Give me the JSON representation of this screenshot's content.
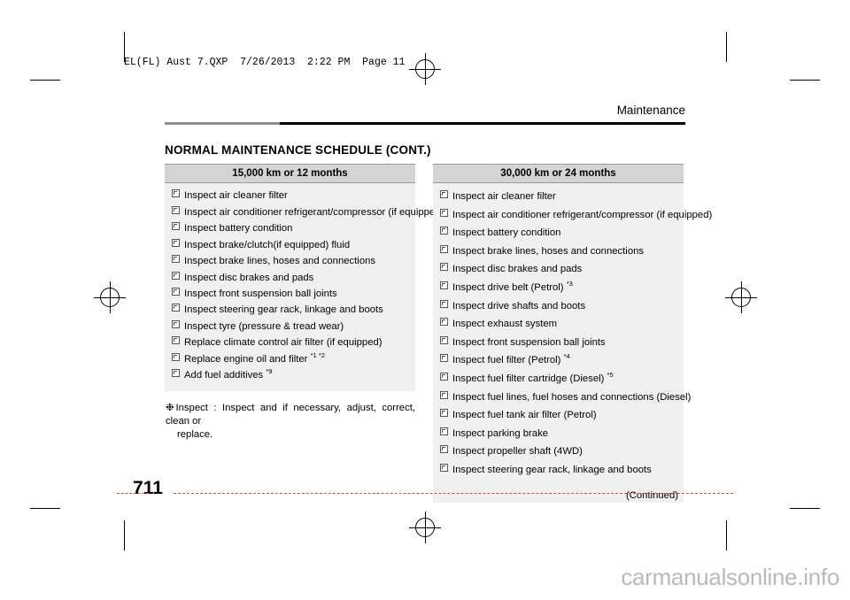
{
  "header": {
    "slug": "EL(FL) Aust 7.QXP  7/26/2013  2:22 PM  Page 11",
    "running_head": "Maintenance"
  },
  "title": "NORMAL MAINTENANCE SCHEDULE (CONT.)",
  "columns": {
    "left": {
      "heading": "15,000 km or 12 months",
      "items": [
        {
          "text": "Inspect air cleaner filter",
          "sup": ""
        },
        {
          "text": "Inspect air conditioner refrigerant/compressor (if equipped)",
          "sup": ""
        },
        {
          "text": "Inspect battery condition",
          "sup": ""
        },
        {
          "text": "Inspect brake/clutch(if equipped) fluid",
          "sup": ""
        },
        {
          "text": "Inspect brake lines, hoses and connections",
          "sup": ""
        },
        {
          "text": "Inspect disc brakes and pads",
          "sup": ""
        },
        {
          "text": "Inspect front suspension ball joints",
          "sup": ""
        },
        {
          "text": "Inspect steering gear rack, linkage and boots",
          "sup": ""
        },
        {
          "text": "Inspect tyre (pressure & tread wear)",
          "sup": ""
        },
        {
          "text": "Replace climate control air filter (if equipped)",
          "sup": ""
        },
        {
          "text": "Replace engine oil and filter ",
          "sup": "*1 *2"
        },
        {
          "text": "Add fuel additives ",
          "sup": "*9"
        }
      ],
      "note_mark": "❉",
      "note_line1": "Inspect : Inspect and if necessary, adjust, correct, clean or",
      "note_line2": "replace."
    },
    "right": {
      "heading": "30,000 km or 24 months",
      "items": [
        {
          "text": "Inspect air cleaner filter",
          "sup": ""
        },
        {
          "text": "Inspect air conditioner refrigerant/compressor (if equipped)",
          "sup": ""
        },
        {
          "text": "Inspect battery condition",
          "sup": ""
        },
        {
          "text": "Inspect brake lines, hoses and connections",
          "sup": ""
        },
        {
          "text": "Inspect disc brakes and pads",
          "sup": ""
        },
        {
          "text": "Inspect drive belt (Petrol) ",
          "sup": "*3"
        },
        {
          "text": "Inspect drive shafts and boots",
          "sup": ""
        },
        {
          "text": "Inspect exhaust system",
          "sup": ""
        },
        {
          "text": "Inspect front suspension ball joints",
          "sup": ""
        },
        {
          "text": "Inspect fuel filter (Petrol) ",
          "sup": "*4"
        },
        {
          "text": "Inspect fuel filter cartridge (Diesel) ",
          "sup": "*5"
        },
        {
          "text": "Inspect fuel lines, fuel hoses and connections (Diesel)",
          "sup": ""
        },
        {
          "text": "Inspect fuel tank air filter (Petrol)",
          "sup": ""
        },
        {
          "text": "Inspect parking brake",
          "sup": ""
        },
        {
          "text": "Inspect propeller shaft (4WD)",
          "sup": ""
        },
        {
          "text": "Inspect steering gear rack, linkage and boots",
          "sup": ""
        }
      ],
      "continued": "(Continued)"
    }
  },
  "footer": {
    "chapter": "7",
    "page": "11"
  },
  "watermark": "carmanualsonline.info",
  "icons": {
    "checkbox": "checkbox-glyph",
    "note": "note-asterisk-icon"
  }
}
